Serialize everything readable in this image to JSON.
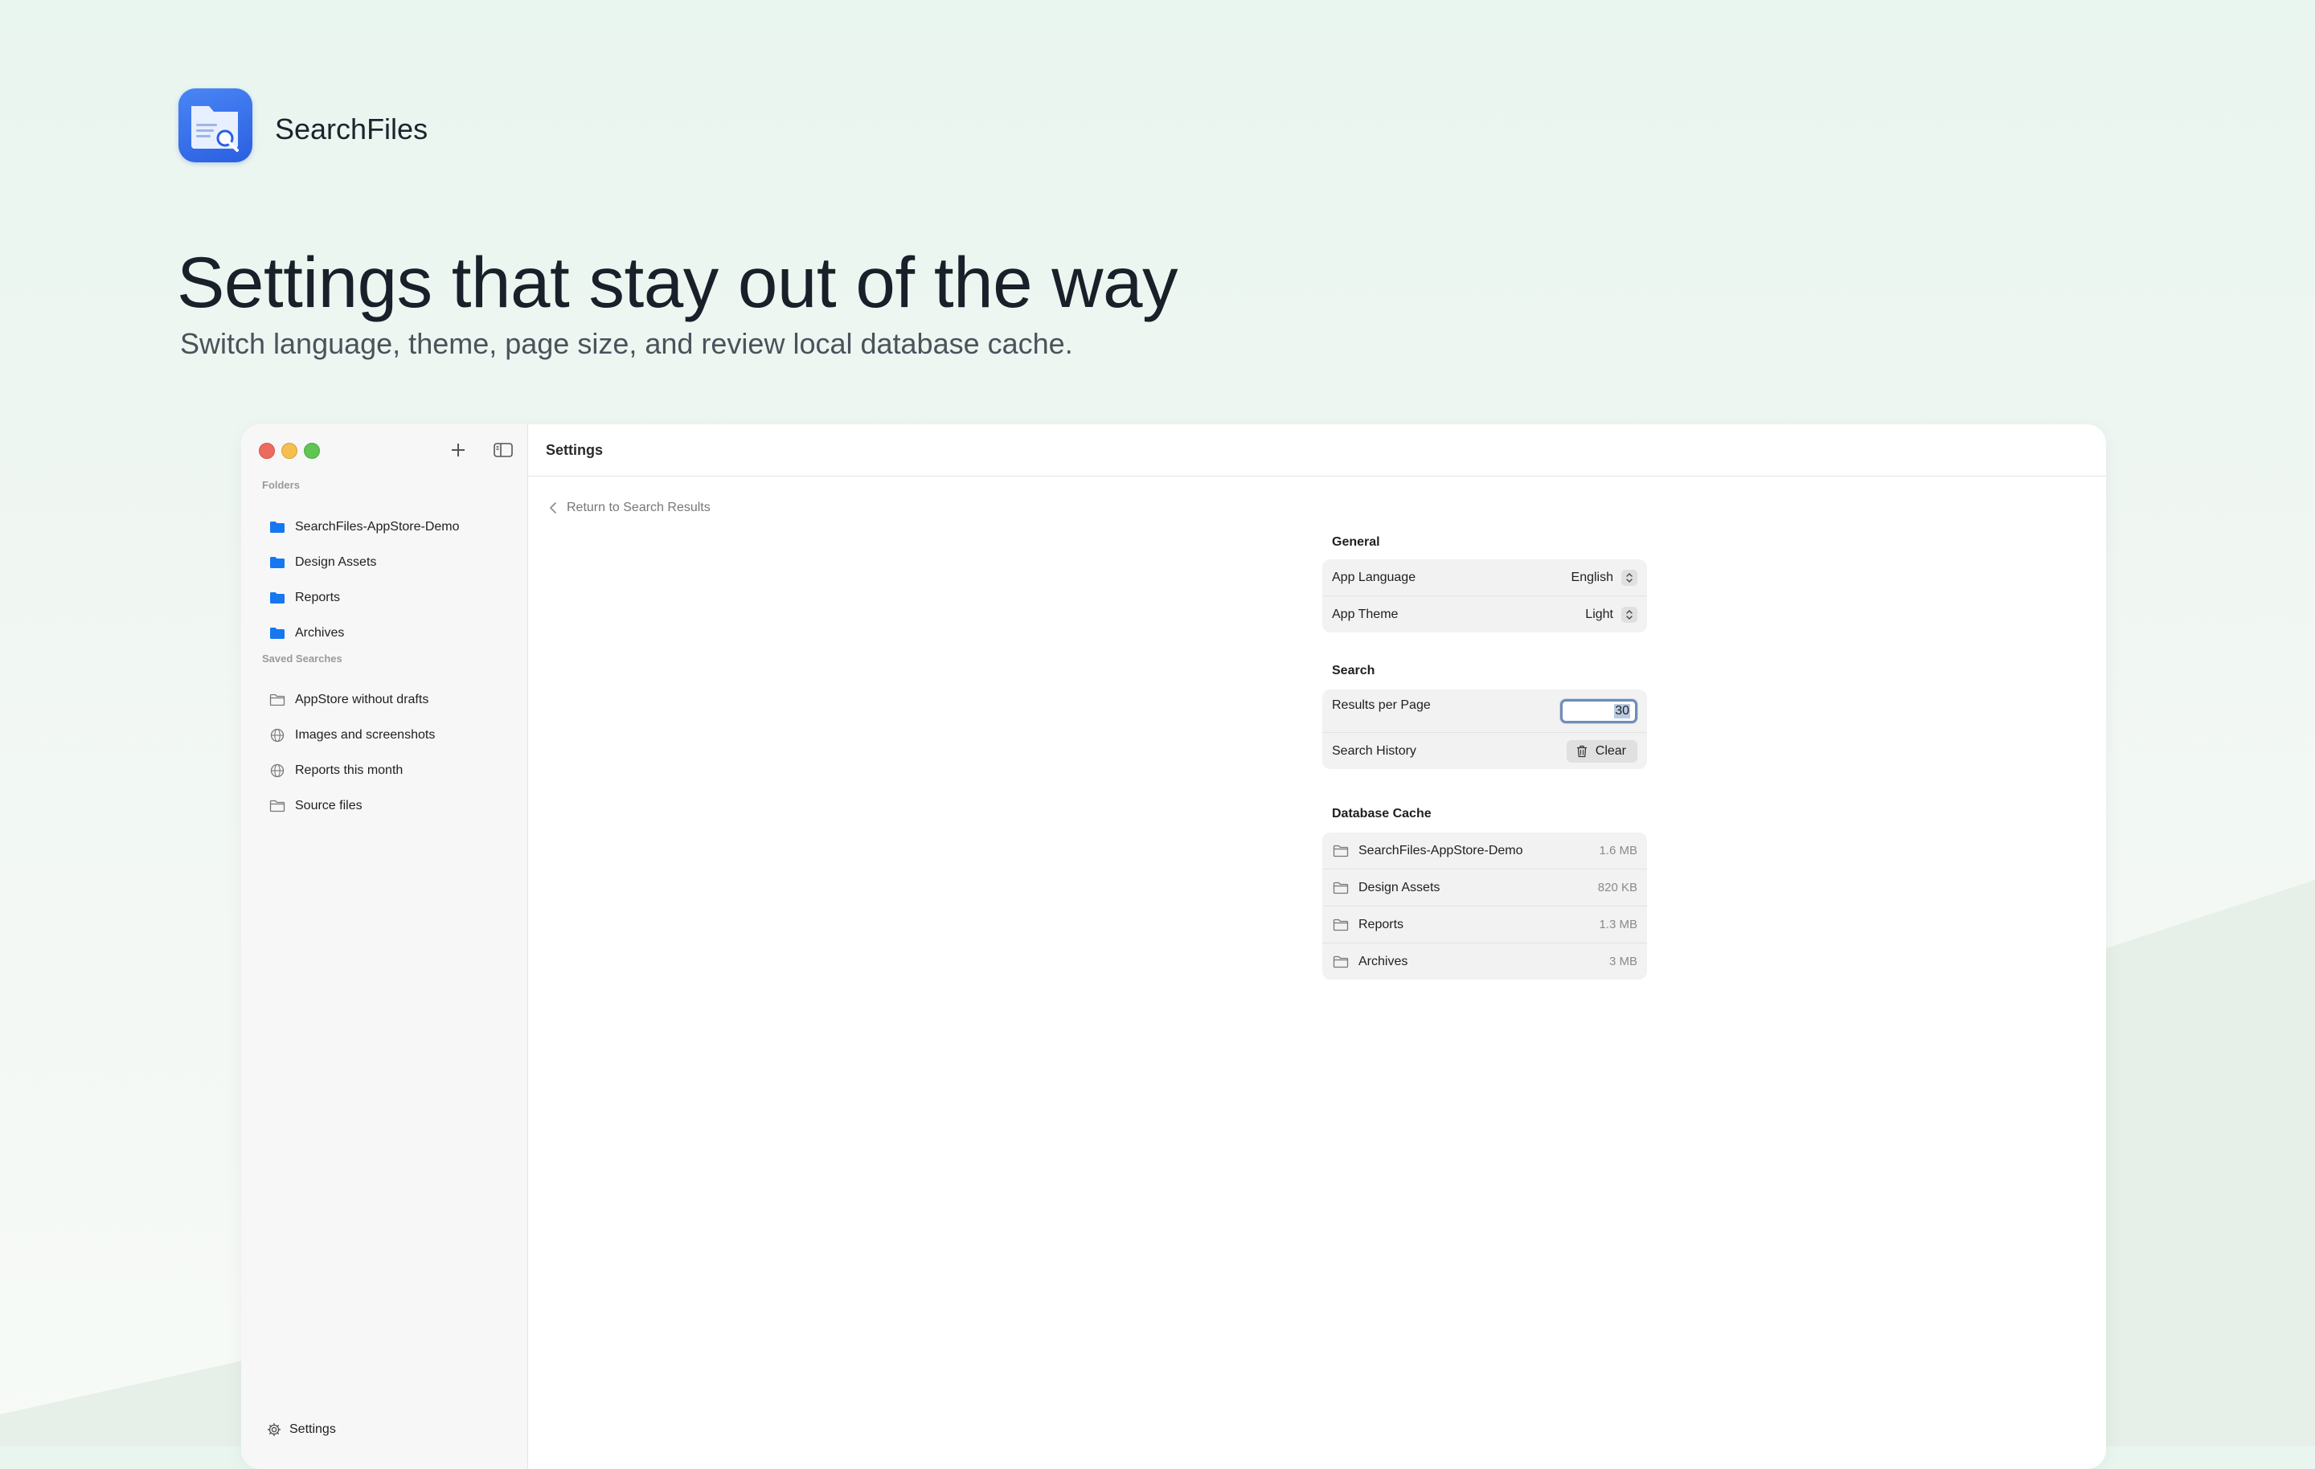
{
  "app": {
    "name": "SearchFiles",
    "icon": "document-search-icon",
    "accent": "#2f6ff0"
  },
  "hero": {
    "title": "Settings that stay out of the way",
    "subtitle": "Switch language, theme, page size, and review local database cache."
  },
  "window": {
    "title": "Settings",
    "controls": [
      "close",
      "minimize",
      "zoom"
    ]
  },
  "sidebar": {
    "folders_label": "Folders",
    "folders": [
      {
        "label": "SearchFiles-AppStore-Demo",
        "icon": "folder-filled-icon"
      },
      {
        "label": "Design Assets",
        "icon": "folder-filled-icon"
      },
      {
        "label": "Reports",
        "icon": "folder-filled-icon"
      },
      {
        "label": "Archives",
        "icon": "folder-filled-icon"
      }
    ],
    "saved_label": "Saved Searches",
    "saved": [
      {
        "label": "AppStore without drafts",
        "icon": "folder-outline-icon"
      },
      {
        "label": "Images and screenshots",
        "icon": "globe-icon"
      },
      {
        "label": "Reports this month",
        "icon": "globe-icon"
      },
      {
        "label": "Source files",
        "icon": "folder-outline-icon"
      }
    ],
    "settings_label": "Settings"
  },
  "settings": {
    "back_label": "Return to Search Results",
    "general": {
      "title": "General",
      "language_label": "App Language",
      "language_value": "English",
      "theme_label": "App Theme",
      "theme_value": "Light"
    },
    "search": {
      "title": "Search",
      "results_label": "Results per Page",
      "results_value": "30",
      "history_label": "Search History",
      "clear_label": "Clear"
    },
    "cache": {
      "title": "Database Cache",
      "items": [
        {
          "name": "SearchFiles-AppStore-Demo",
          "size": "1.6 MB"
        },
        {
          "name": "Design Assets",
          "size": "820 KB"
        },
        {
          "name": "Reports",
          "size": "1.3 MB"
        },
        {
          "name": "Archives",
          "size": "3 MB"
        }
      ]
    }
  }
}
